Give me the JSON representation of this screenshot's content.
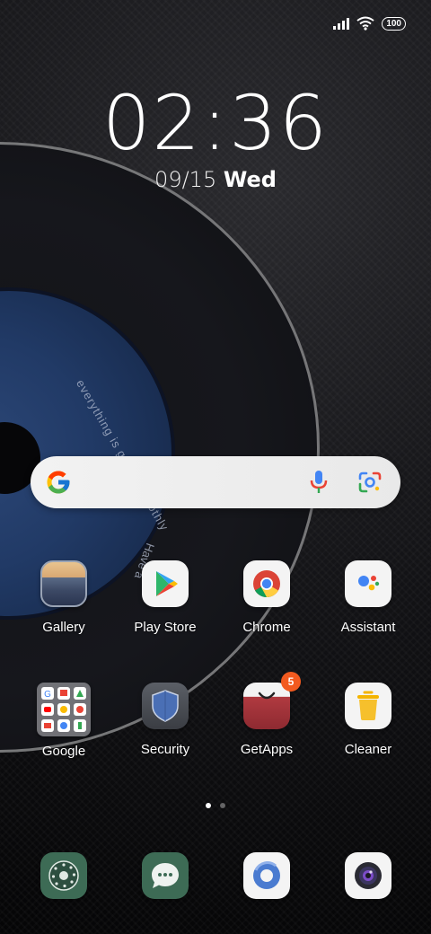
{
  "status_bar": {
    "signal_icon": "cell-signal-icon",
    "wifi_icon": "wifi-icon",
    "battery": "100"
  },
  "wallpaper": {
    "label_text_1": "everything is going smoothly",
    "label_text_2": "Have a"
  },
  "clock": {
    "time": "02:36",
    "date": "09/15",
    "weekday": "Wed"
  },
  "search_bar": {
    "logo_icon": "google-g-icon",
    "mic_icon": "microphone-icon",
    "lens_icon": "google-lens-icon"
  },
  "apps": [
    {
      "label": "Gallery",
      "icon": "gallery-icon"
    },
    {
      "label": "Play Store",
      "icon": "play-store-icon"
    },
    {
      "label": "Chrome",
      "icon": "chrome-icon"
    },
    {
      "label": "Assistant",
      "icon": "assistant-icon"
    },
    {
      "label": "Google",
      "icon": "google-folder-icon"
    },
    {
      "label": "Security",
      "icon": "security-shield-icon"
    },
    {
      "label": "GetApps",
      "icon": "getapps-bag-icon",
      "badge": "5"
    },
    {
      "label": "Cleaner",
      "icon": "cleaner-trash-icon"
    }
  ],
  "dock": [
    {
      "icon": "phone-dialer-icon"
    },
    {
      "icon": "messages-icon"
    },
    {
      "icon": "browser-icon"
    },
    {
      "icon": "camera-icon"
    }
  ],
  "pages": {
    "count": 2,
    "active": 1
  },
  "colors": {
    "badge": "#f25a1f",
    "search_bg": "#f0f0f0",
    "wallpaper_label": "#213a66"
  }
}
